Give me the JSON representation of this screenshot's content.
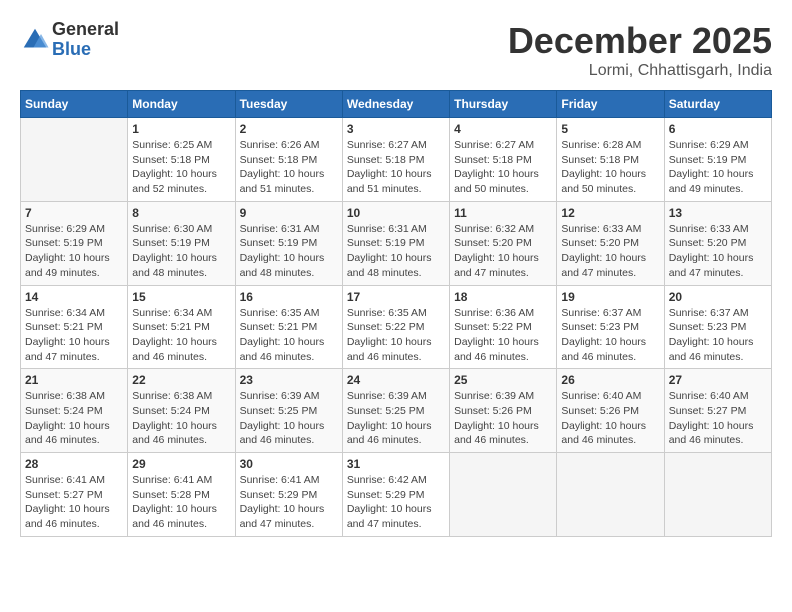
{
  "logo": {
    "general": "General",
    "blue": "Blue"
  },
  "header": {
    "month": "December 2025",
    "location": "Lormi, Chhattisgarh, India"
  },
  "weekdays": [
    "Sunday",
    "Monday",
    "Tuesday",
    "Wednesday",
    "Thursday",
    "Friday",
    "Saturday"
  ],
  "weeks": [
    [
      {
        "day": "",
        "info": ""
      },
      {
        "day": "1",
        "info": "Sunrise: 6:25 AM\nSunset: 5:18 PM\nDaylight: 10 hours\nand 52 minutes."
      },
      {
        "day": "2",
        "info": "Sunrise: 6:26 AM\nSunset: 5:18 PM\nDaylight: 10 hours\nand 51 minutes."
      },
      {
        "day": "3",
        "info": "Sunrise: 6:27 AM\nSunset: 5:18 PM\nDaylight: 10 hours\nand 51 minutes."
      },
      {
        "day": "4",
        "info": "Sunrise: 6:27 AM\nSunset: 5:18 PM\nDaylight: 10 hours\nand 50 minutes."
      },
      {
        "day": "5",
        "info": "Sunrise: 6:28 AM\nSunset: 5:18 PM\nDaylight: 10 hours\nand 50 minutes."
      },
      {
        "day": "6",
        "info": "Sunrise: 6:29 AM\nSunset: 5:19 PM\nDaylight: 10 hours\nand 49 minutes."
      }
    ],
    [
      {
        "day": "7",
        "info": "Sunrise: 6:29 AM\nSunset: 5:19 PM\nDaylight: 10 hours\nand 49 minutes."
      },
      {
        "day": "8",
        "info": "Sunrise: 6:30 AM\nSunset: 5:19 PM\nDaylight: 10 hours\nand 48 minutes."
      },
      {
        "day": "9",
        "info": "Sunrise: 6:31 AM\nSunset: 5:19 PM\nDaylight: 10 hours\nand 48 minutes."
      },
      {
        "day": "10",
        "info": "Sunrise: 6:31 AM\nSunset: 5:19 PM\nDaylight: 10 hours\nand 48 minutes."
      },
      {
        "day": "11",
        "info": "Sunrise: 6:32 AM\nSunset: 5:20 PM\nDaylight: 10 hours\nand 47 minutes."
      },
      {
        "day": "12",
        "info": "Sunrise: 6:33 AM\nSunset: 5:20 PM\nDaylight: 10 hours\nand 47 minutes."
      },
      {
        "day": "13",
        "info": "Sunrise: 6:33 AM\nSunset: 5:20 PM\nDaylight: 10 hours\nand 47 minutes."
      }
    ],
    [
      {
        "day": "14",
        "info": "Sunrise: 6:34 AM\nSunset: 5:21 PM\nDaylight: 10 hours\nand 47 minutes."
      },
      {
        "day": "15",
        "info": "Sunrise: 6:34 AM\nSunset: 5:21 PM\nDaylight: 10 hours\nand 46 minutes."
      },
      {
        "day": "16",
        "info": "Sunrise: 6:35 AM\nSunset: 5:21 PM\nDaylight: 10 hours\nand 46 minutes."
      },
      {
        "day": "17",
        "info": "Sunrise: 6:35 AM\nSunset: 5:22 PM\nDaylight: 10 hours\nand 46 minutes."
      },
      {
        "day": "18",
        "info": "Sunrise: 6:36 AM\nSunset: 5:22 PM\nDaylight: 10 hours\nand 46 minutes."
      },
      {
        "day": "19",
        "info": "Sunrise: 6:37 AM\nSunset: 5:23 PM\nDaylight: 10 hours\nand 46 minutes."
      },
      {
        "day": "20",
        "info": "Sunrise: 6:37 AM\nSunset: 5:23 PM\nDaylight: 10 hours\nand 46 minutes."
      }
    ],
    [
      {
        "day": "21",
        "info": "Sunrise: 6:38 AM\nSunset: 5:24 PM\nDaylight: 10 hours\nand 46 minutes."
      },
      {
        "day": "22",
        "info": "Sunrise: 6:38 AM\nSunset: 5:24 PM\nDaylight: 10 hours\nand 46 minutes."
      },
      {
        "day": "23",
        "info": "Sunrise: 6:39 AM\nSunset: 5:25 PM\nDaylight: 10 hours\nand 46 minutes."
      },
      {
        "day": "24",
        "info": "Sunrise: 6:39 AM\nSunset: 5:25 PM\nDaylight: 10 hours\nand 46 minutes."
      },
      {
        "day": "25",
        "info": "Sunrise: 6:39 AM\nSunset: 5:26 PM\nDaylight: 10 hours\nand 46 minutes."
      },
      {
        "day": "26",
        "info": "Sunrise: 6:40 AM\nSunset: 5:26 PM\nDaylight: 10 hours\nand 46 minutes."
      },
      {
        "day": "27",
        "info": "Sunrise: 6:40 AM\nSunset: 5:27 PM\nDaylight: 10 hours\nand 46 minutes."
      }
    ],
    [
      {
        "day": "28",
        "info": "Sunrise: 6:41 AM\nSunset: 5:27 PM\nDaylight: 10 hours\nand 46 minutes."
      },
      {
        "day": "29",
        "info": "Sunrise: 6:41 AM\nSunset: 5:28 PM\nDaylight: 10 hours\nand 46 minutes."
      },
      {
        "day": "30",
        "info": "Sunrise: 6:41 AM\nSunset: 5:29 PM\nDaylight: 10 hours\nand 47 minutes."
      },
      {
        "day": "31",
        "info": "Sunrise: 6:42 AM\nSunset: 5:29 PM\nDaylight: 10 hours\nand 47 minutes."
      },
      {
        "day": "",
        "info": ""
      },
      {
        "day": "",
        "info": ""
      },
      {
        "day": "",
        "info": ""
      }
    ]
  ]
}
